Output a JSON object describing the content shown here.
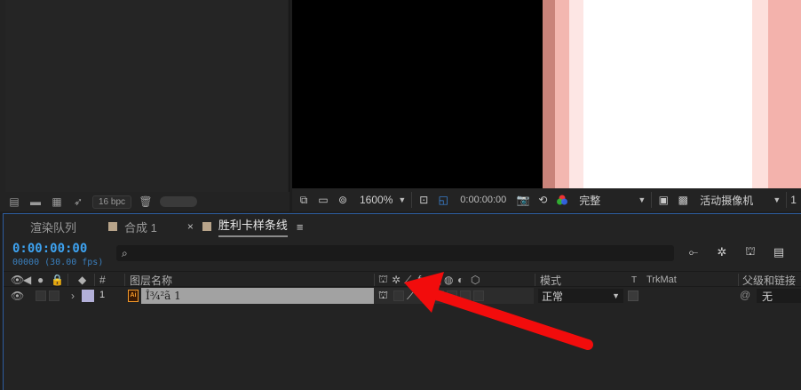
{
  "project_panel": {
    "footer": {
      "bpc_label": "16 bpc"
    }
  },
  "viewer": {
    "toolbar": {
      "zoom_value": "1600%",
      "timecode": "0:00:00:00",
      "resolution_value": "完整",
      "camera_value": "活动摄像机",
      "views_value": "1"
    }
  },
  "timeline": {
    "tabs": [
      {
        "label": "渲染队列",
        "active": false,
        "has_swatch": false
      },
      {
        "label": "合成 1",
        "active": false,
        "has_swatch": true
      },
      {
        "label": "胜利卡样条线",
        "active": true,
        "has_swatch": true
      }
    ],
    "tab_close_glyph": "×",
    "tab_menu_glyph": "≡",
    "current_time": "0:00:00:00",
    "frame_info": "00000 (30.00 fps)",
    "search_placeholder": "⌕",
    "columns": {
      "number": "#",
      "layer_name": "图层名称",
      "mode": "模式",
      "t": "T",
      "trkmat": "TrkMat",
      "parent": "父级和链接"
    },
    "layers": [
      {
        "number": "1",
        "name": "Î¾²ã 1",
        "source_type": "Ai",
        "mode": "正常",
        "parent": "无",
        "label_color": "#b3b0d9"
      }
    ]
  },
  "colors": {
    "time_blue": "#3da2f0",
    "panel_border_blue": "#2d5da0",
    "annotation_arrow": "#f20c0c"
  }
}
